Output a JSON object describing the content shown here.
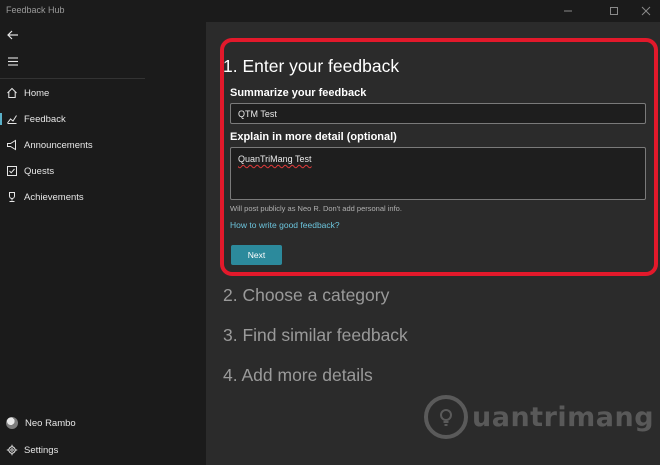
{
  "window": {
    "title": "Feedback Hub",
    "controls": [
      "minimize",
      "maximize",
      "close"
    ]
  },
  "sidebar": {
    "items": [
      {
        "label": "Home",
        "icon": "home-icon"
      },
      {
        "label": "Feedback",
        "icon": "feedback-icon",
        "active": true
      },
      {
        "label": "Announcements",
        "icon": "megaphone-icon"
      },
      {
        "label": "Quests",
        "icon": "quests-icon"
      },
      {
        "label": "Achievements",
        "icon": "trophy-icon"
      }
    ],
    "user": {
      "name": "Neo Rambo"
    },
    "settings_label": "Settings"
  },
  "main": {
    "step1": {
      "title": "1. Enter your feedback",
      "summary_label": "Summarize your feedback",
      "summary_value": "QTM Test",
      "detail_label": "Explain in more detail (optional)",
      "detail_value": "QuanTriMang Test",
      "privacy_note": "Will post publicly as Neo R. Don't add personal info.",
      "help_link": "How to write good feedback?",
      "next_label": "Next"
    },
    "step2_title": "2. Choose a category",
    "step3_title": "3. Find similar feedback",
    "step4_title": "4. Add more details"
  },
  "watermark": {
    "text": "uantrimang"
  },
  "colors": {
    "accent": "#2c8a9c",
    "link": "#6cc4dc",
    "highlight": "#e2192b",
    "sidebar_bg": "#1b1b1b",
    "main_bg": "#2b2b2b"
  }
}
